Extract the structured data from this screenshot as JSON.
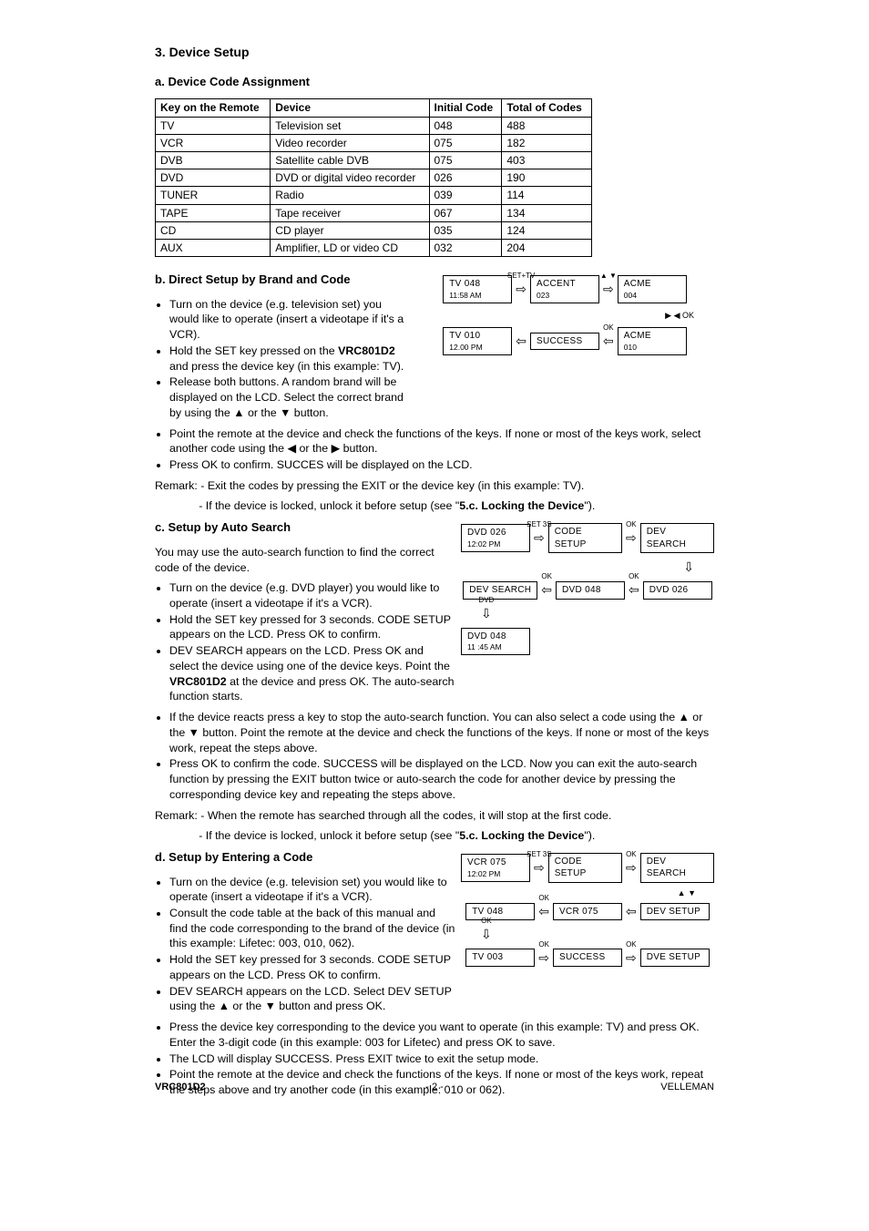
{
  "title": "3. Device Setup",
  "sectionA": {
    "heading": "a. Device Code Assignment",
    "headers": [
      "Key on the Remote",
      "Device",
      "Initial Code",
      "Total of Codes"
    ],
    "rows": [
      [
        "TV",
        "Television set",
        "048",
        "488"
      ],
      [
        "VCR",
        "Video recorder",
        "075",
        "182"
      ],
      [
        "DVB",
        "Satellite cable DVB",
        "075",
        "403"
      ],
      [
        "DVD",
        "DVD or digital video recorder",
        "026",
        "190"
      ],
      [
        "TUNER",
        "Radio",
        "039",
        "114"
      ],
      [
        "TAPE",
        "Tape receiver",
        "067",
        "134"
      ],
      [
        "CD",
        "CD player",
        "035",
        "124"
      ],
      [
        "AUX",
        "Amplifier, LD or video CD",
        "032",
        "204"
      ]
    ]
  },
  "sectionB": {
    "heading": "b. Direct Setup by Brand and Code",
    "bullets": [
      "Turn on the device (e.g. television set) you would like to operate (insert a videotape if it's a VCR).",
      "Hold the SET key pressed on the <b>VRC801D2</b> and press the device key (in this example: TV).",
      "Release both buttons. A random brand will be displayed on the LCD. Select the correct brand by using the ▲ or the ▼ button.",
      "Point the remote at the device and check the functions of the keys. If none or most of the keys work, select another code using the ◀ or the ▶ button.",
      "Press OK to confirm. SUCCES will be displayed on the LCD."
    ],
    "remark": "Remark: - Exit the codes by pressing the EXIT or the device key (in this example: TV).",
    "remark2": "              - If the device is locked, unlock it before setup (see \"<b>5.c. Locking the Device</b>\").",
    "flow": {
      "b1": {
        "l1": "TV          048",
        "l2": "11:58 AM"
      },
      "lbl1": "SET+TV",
      "b2": {
        "l1": "ACCENT",
        "l2": "023"
      },
      "lbl2": "▲  ▼",
      "b3": {
        "l1": "ACME",
        "l2": "004"
      },
      "lbl3": "▶ ◀  OK",
      "b4": {
        "l1": "TV          010",
        "l2": "12.00 PM"
      },
      "lbl4": "OK",
      "b5": {
        "l1": "SUCCESS"
      },
      "b6": {
        "l1": "ACME",
        "l2": "010"
      }
    }
  },
  "sectionC": {
    "heading": "c. Setup by Auto Search",
    "intro": "You may use the auto-search function to find the correct code of the device.",
    "bullets": [
      "Turn on the device (e.g. DVD player) you would like to operate (insert a videotape if it's a VCR).",
      "Hold the SET key pressed for 3 seconds. CODE SETUP appears on the LCD. Press OK to confirm.",
      "DEV SEARCH appears on the LCD. Press OK and select the device using one of the device keys. Point the <b>VRC801D2</b> at the device and press OK. The auto-search function starts.",
      "If the device reacts press a key to stop the auto-search function. You can also select a code using the ▲ or the ▼ button. Point the remote at the device and check the functions of the keys. If none or most of the keys work, repeat the steps above.",
      "Press OK to confirm the code. SUCCESS will be displayed on the LCD. Now you can exit the auto-search function by pressing the EXIT button twice or auto-search the code for another device by pressing the corresponding device key and repeating the steps above."
    ],
    "remark": "Remark: - When the remote has searched through all the codes, it will stop at the first code.",
    "remark2": "              - If the device is locked, unlock it before setup (see \"<b>5.c. Locking the Device</b>\").",
    "flow": {
      "b1": {
        "l1": "DVD       026",
        "l2": "12:02 PM"
      },
      "lbl1": "SET 3S",
      "b2": {
        "l1": "CODE SETUP"
      },
      "lbl2": "OK",
      "b3": {
        "l1": "DEV SEARCH"
      },
      "b4": {
        "l1": "DEV SEARCH"
      },
      "lbl3": "OK",
      "b5": {
        "l1": "DVD       048"
      },
      "lbl4": "OK",
      "b6": {
        "l1": "DVD   026"
      },
      "lbl5": "DVD",
      "b7": {
        "l1": "DVD       048",
        "l2": "11 :45 AM"
      }
    }
  },
  "sectionD": {
    "heading": "d. Setup by Entering a Code",
    "bullets": [
      "Turn on the device (e.g. television set) you would like to operate (insert a videotape if it's a VCR).",
      "Consult the code table at the back of this manual and find the code corresponding to the brand of the device (in this example: Lifetec: 003, 010, 062).",
      "Hold the SET key pressed for 3 seconds. CODE SETUP appears on the LCD. Press OK to confirm.",
      "DEV SEARCH appears on the LCD. Select DEV SETUP using the ▲ or the ▼ button and press OK.",
      "Press the device key corresponding to the device you want to operate (in this example: TV) and press OK. Enter the 3-digit code (in this example: 003 for Lifetec) and press OK to save.",
      "The LCD will display SUCCESS. Press EXIT twice to exit the setup mode.",
      "Point the remote at the device and check the functions of the keys. If none or most of the keys work, repeat the steps above and try another code (in this example: 010 or 062)."
    ],
    "flow": {
      "b1": {
        "l1": "VCR       075",
        "l2": "12:02 PM"
      },
      "lbl1": "SET 3S",
      "b2": {
        "l1": "CODE SETUP"
      },
      "lbl2": "OK",
      "b3": {
        "l1": "DEV SEARCH"
      },
      "lbl3": "▲ ▼",
      "b4": {
        "l1": "TV          048"
      },
      "lbl4": "OK",
      "b5": {
        "l1": "VCR       075"
      },
      "b6": {
        "l1": "DEV  SETUP"
      },
      "lbl5": "OK",
      "b7": {
        "l1": "TV          003"
      },
      "lbl6": "OK",
      "b8": {
        "l1": "SUCCESS"
      },
      "lbl7": "OK",
      "b9": {
        "l1": "DVE SETUP"
      }
    }
  },
  "footer": {
    "left": "VRC801D2",
    "center": "- 2 -",
    "right": "VELLEMAN"
  }
}
